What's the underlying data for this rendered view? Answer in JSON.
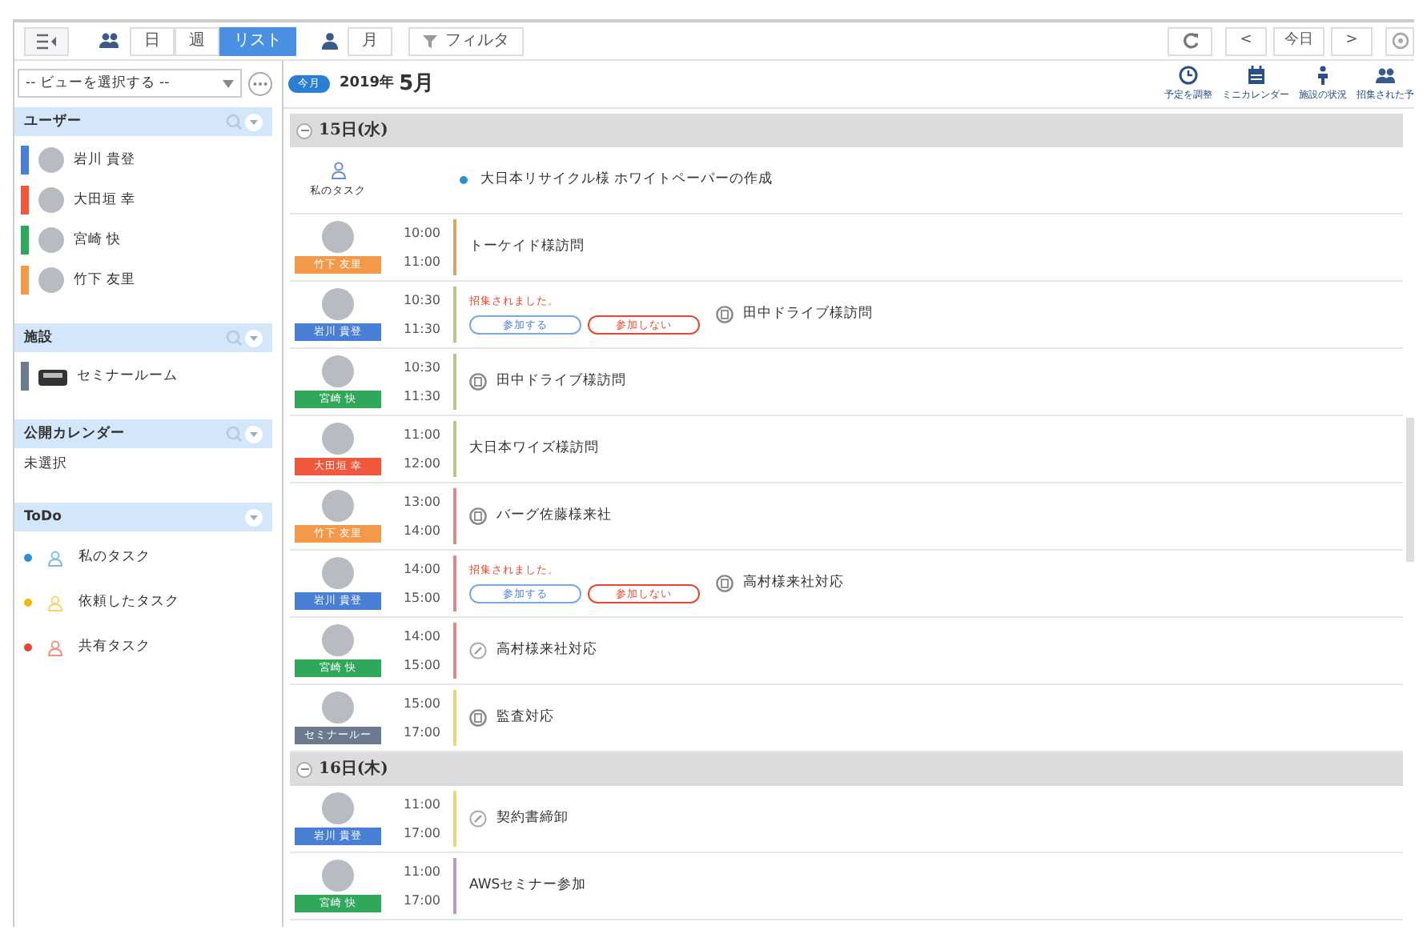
{
  "toolbar": {
    "items": [
      {
        "kind": "collapse"
      },
      {
        "kind": "group"
      },
      {
        "kind": "tab",
        "label": "日",
        "selected": false
      },
      {
        "kind": "tab",
        "label": "週",
        "selected": false
      },
      {
        "kind": "tab",
        "label": "リスト",
        "selected": true
      },
      {
        "kind": "person"
      },
      {
        "kind": "tab",
        "label": "月",
        "selected": false
      },
      {
        "kind": "filter",
        "label": "フィルタ"
      }
    ],
    "nav": [
      {
        "kind": "refresh"
      },
      {
        "kind": "text",
        "label": "<"
      },
      {
        "kind": "text",
        "label": "今日"
      },
      {
        "kind": "text",
        "label": ">"
      },
      {
        "kind": "settings"
      }
    ]
  },
  "view_select": {
    "value": "-- ビューを選択する --"
  },
  "sidebar": {
    "sections": [
      {
        "title": "ユーザー",
        "search": true,
        "items": [
          {
            "kind": "user",
            "label": "岩川 貴登",
            "color": "#4a7fd6"
          },
          {
            "kind": "user",
            "label": "大田垣 幸",
            "color": "#f0573b"
          },
          {
            "kind": "user",
            "label": "宮崎 快",
            "color": "#2fa85a"
          },
          {
            "kind": "user",
            "label": "竹下 友里",
            "color": "#f29a4a"
          }
        ]
      },
      {
        "title": "施設",
        "search": true,
        "items": [
          {
            "kind": "facility",
            "label": "セミナールーム",
            "color": "#6b7a8f"
          }
        ]
      },
      {
        "title": "公開カレンダー",
        "search": true,
        "items": [
          {
            "kind": "plain",
            "label": "未選択"
          }
        ]
      },
      {
        "title": "ToDo",
        "search": false,
        "items": [
          {
            "kind": "task",
            "label": "私のタスク",
            "color": "#2e8fd0"
          },
          {
            "kind": "task",
            "label": "依頼したタスク",
            "color": "#f2b705"
          },
          {
            "kind": "task",
            "label": "共有タスク",
            "color": "#e8472f"
          }
        ]
      }
    ]
  },
  "header": {
    "today": "今月",
    "year": "2019年",
    "month": "5月",
    "tools": [
      {
        "kind": "clock",
        "label": "予定を調整"
      },
      {
        "kind": "calendar",
        "label": "ミニカレンダー"
      },
      {
        "kind": "facility",
        "label": "施設の状況"
      },
      {
        "kind": "group",
        "label": "招集された予"
      }
    ]
  },
  "days": [
    {
      "title": "15日(水)",
      "rows": [
        {
          "kind": "task",
          "owner": {
            "name": "私のタスク"
          },
          "title": "大日本リサイクル様 ホワイトペーパーの作成",
          "color": "#2e8fd0"
        },
        {
          "kind": "event",
          "owner": {
            "name": "竹下 友里",
            "color": "#f29a4a"
          },
          "start": "10:00",
          "end": "11:00",
          "title": "トーケイド様訪問",
          "color": "#d9a36a"
        },
        {
          "kind": "meeting",
          "owner": {
            "name": "岩川 貴登",
            "color": "#4a7fd6"
          },
          "start": "10:30",
          "end": "11:30",
          "title": "田中ドライブ様訪問",
          "color": "#b6c98a",
          "invite": {
            "message": "招集されました。",
            "accept": "参加する",
            "decline": "参加しない"
          }
        },
        {
          "kind": "meeting",
          "owner": {
            "name": "宮崎 快",
            "color": "#2fa85a"
          },
          "start": "10:30",
          "end": "11:30",
          "title": "田中ドライブ様訪問",
          "color": "#b6c98a"
        },
        {
          "kind": "event",
          "owner": {
            "name": "大田垣 幸",
            "color": "#f0573b"
          },
          "start": "11:00",
          "end": "12:00",
          "title": "大日本ワイズ様訪問",
          "color": "#b6c98a"
        },
        {
          "kind": "meeting",
          "owner": {
            "name": "竹下 友里",
            "color": "#f29a4a"
          },
          "start": "13:00",
          "end": "14:00",
          "title": "バーグ佐藤様来社",
          "color": "#d98a8a"
        },
        {
          "kind": "meeting",
          "owner": {
            "name": "岩川 貴登",
            "color": "#4a7fd6"
          },
          "start": "14:00",
          "end": "15:00",
          "title": "高村様来社対応",
          "color": "#d98a8a",
          "invite": {
            "message": "招集されました。",
            "accept": "参加する",
            "decline": "参加しない"
          }
        },
        {
          "kind": "memo",
          "owner": {
            "name": "宮崎 快",
            "color": "#2fa85a"
          },
          "start": "14:00",
          "end": "15:00",
          "title": "高村様来社対応",
          "color": "#d98a8a"
        },
        {
          "kind": "meeting",
          "owner": {
            "name": "セミナールー",
            "color": "#6b7a8f"
          },
          "start": "15:00",
          "end": "17:00",
          "title": "監査対応",
          "color": "#e6d77a"
        }
      ]
    },
    {
      "title": "16日(木)",
      "rows": [
        {
          "kind": "memo",
          "owner": {
            "name": "岩川 貴登",
            "color": "#4a7fd6"
          },
          "start": "11:00",
          "end": "17:00",
          "title": "契約書締卸",
          "color": "#e6d77a"
        },
        {
          "kind": "event",
          "owner": {
            "name": "宮崎 快",
            "color": "#2fa85a"
          },
          "start": "11:00",
          "end": "17:00",
          "title": "AWSセミナー参加",
          "color": "#b89ad0"
        }
      ]
    }
  ]
}
